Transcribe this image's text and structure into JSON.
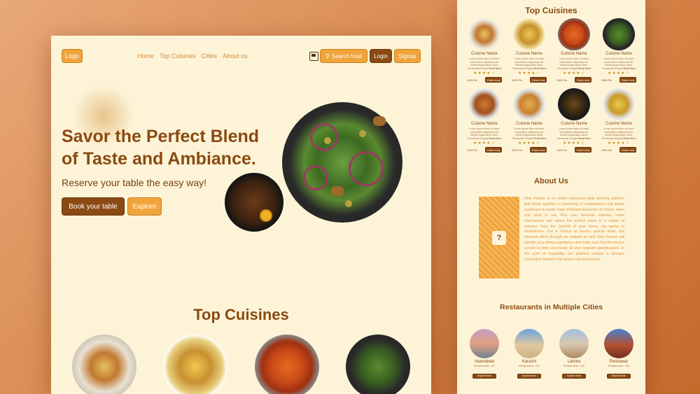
{
  "main": {
    "logo": "Logo",
    "nav": [
      "Home",
      "Top Cuisines",
      "Cities",
      "About us"
    ],
    "search_label": "Search food",
    "login": "Login",
    "signup": "Signup",
    "hero_title": "Savor the Perfect Blend of Taste and Ambiance.",
    "hero_subtitle": "Reserve your table the easy way!",
    "book_button": "Book your table",
    "explore_button": "Explore",
    "top_cuisines_title": "Top Cuisines"
  },
  "side": {
    "top_cuisines_title": "Top Cuisines",
    "cuisine_name": "Cuisine Name",
    "cuisine_desc": "Lorem ipsum dolor sit amet, consectetur adipiscing elit. Mollis feugiat lacus amet. Fermentum fringilla",
    "read_more": "Read More",
    "stars": "★★★★☆",
    "price": "1500 Rs",
    "order_button": "Order now",
    "about_title": "About Us",
    "about_text": "Dine Partner is an online restaurant table booking platform that brings together a community of restaurateurs and allows customers to easily make informed decisions on where, when and what to eat. Pick your favourite eateries, make reservations and select the perfect menu in a matter of minutes, from the comfort of your home, via laptop or smartphone. Get a chance to access special deals and discount offers through our website as well. Dine Partner will elevate your dining experience and make sure that the food is served on time and meets all your required specifications. In the spirit of hospitality, our platform creates a stronger connection between the diners and restaurants.",
    "cities_title": "Restaurants in Multiple Cities",
    "cities": [
      {
        "name": "Islamabad",
        "count": "Restaurants: 167"
      },
      {
        "name": "Karachi",
        "count": "Restaurants: 112"
      },
      {
        "name": "Lahore",
        "count": "Restaurants: 120"
      },
      {
        "name": "Peshawar",
        "count": "Restaurants: 150"
      }
    ],
    "explore_now": "Explore Now"
  },
  "colors": {
    "accent": "#f0a43c",
    "brand_dark": "#8a4a12",
    "page_bg": "#fdf4d8"
  }
}
